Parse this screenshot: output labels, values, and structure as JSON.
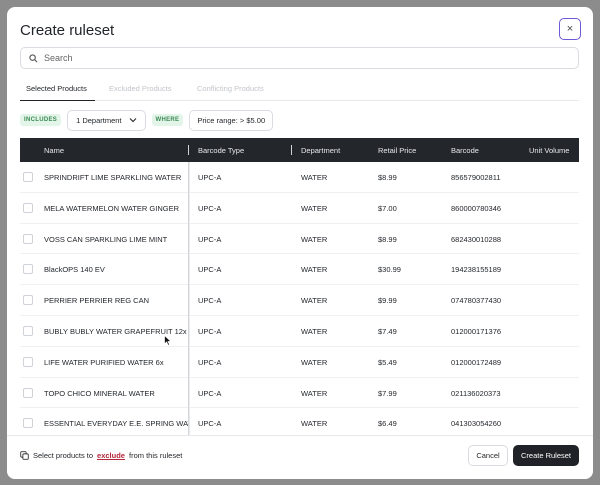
{
  "modal": {
    "title": "Create ruleset",
    "close_icon": "×"
  },
  "search": {
    "placeholder": "Search",
    "value": ""
  },
  "tabs": [
    {
      "label": "Selected Products",
      "active": true
    },
    {
      "label": "Excluded Products",
      "active": false
    },
    {
      "label": "Conflicting Products",
      "active": false
    }
  ],
  "filters": {
    "includes_label": "INCLUDES",
    "department_value": "1 Department",
    "where_label": "WHERE",
    "condition": "Price range: > $5.00"
  },
  "table": {
    "columns": [
      "Name",
      "Barcode Type",
      "Department",
      "Retail Price",
      "Barcode",
      "Unit Volume"
    ],
    "rows": [
      {
        "name": "SPRINDRIFT LIME SPARKLING WATER",
        "barcode_type": "UPC-A",
        "department": "WATER",
        "price": "$8.99",
        "barcode": "856579002811",
        "unit_volume": ""
      },
      {
        "name": "MELA WATERMELON WATER GINGER",
        "barcode_type": "UPC-A",
        "department": "WATER",
        "price": "$7.00",
        "barcode": "860000780346",
        "unit_volume": ""
      },
      {
        "name": "VOSS CAN SPARKLING LIME MINT",
        "barcode_type": "UPC-A",
        "department": "WATER",
        "price": "$8.99",
        "barcode": "682430010288",
        "unit_volume": ""
      },
      {
        "name": "BlackOPS 140 EV",
        "barcode_type": "UPC-A",
        "department": "WATER",
        "price": "$30.99",
        "barcode": "194238155189",
        "unit_volume": ""
      },
      {
        "name": "PERRIER PERRIER REG CAN",
        "barcode_type": "UPC-A",
        "department": "WATER",
        "price": "$9.99",
        "barcode": "074780377430",
        "unit_volume": ""
      },
      {
        "name": "BUBLY BUBLY WATER GRAPEFRUIT 12x",
        "barcode_type": "UPC-A",
        "department": "WATER",
        "price": "$7.49",
        "barcode": "012000171376",
        "unit_volume": ""
      },
      {
        "name": "LIFE WATER PURIFIED WATER 6x",
        "barcode_type": "UPC-A",
        "department": "WATER",
        "price": "$5.49",
        "barcode": "012000172489",
        "unit_volume": ""
      },
      {
        "name": "TOPO CHICO MINERAL WATER",
        "barcode_type": "UPC-A",
        "department": "WATER",
        "price": "$7.99",
        "barcode": "021136020373",
        "unit_volume": ""
      },
      {
        "name": "ESSENTIAL EVERYDAY E.E. SPRING WATER",
        "barcode_type": "UPC-A",
        "department": "WATER",
        "price": "$6.49",
        "barcode": "041303054260",
        "unit_volume": ""
      }
    ]
  },
  "footer": {
    "note_prefix": "Select products to",
    "note_link": "exclude",
    "note_suffix": "from this ruleset",
    "cancel_label": "Cancel",
    "create_label": "Create Ruleset"
  },
  "colors": {
    "accent": "#6b5bd6",
    "header_bg": "#23262b",
    "primary_button": "#1f2226",
    "danger_link": "#b5283b",
    "pill_bg": "#e3f4e8",
    "pill_text": "#3b8a54"
  }
}
